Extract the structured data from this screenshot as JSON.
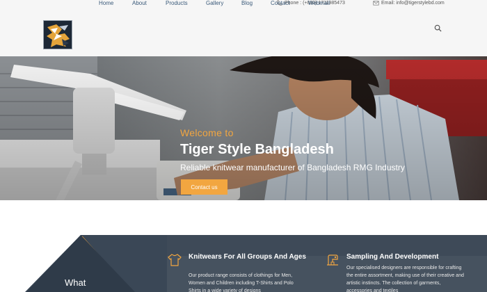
{
  "topbar": {
    "phone": "Phone : (+880) 1711985473",
    "email": "Email: info@tigerstylebd.com"
  },
  "nav": {
    "items": [
      "Home",
      "About",
      "Products",
      "Gallery",
      "Blog",
      "Contact",
      "Webmail"
    ]
  },
  "hero": {
    "welcome": "Welcome to",
    "title": "Tiger Style Bangladesh",
    "subtitle": "Reliable knitwear manufacturer of Bangladesh RMG Industry",
    "button": "Contact us",
    "accent": "#f2a640"
  },
  "features": {
    "what_label": "What",
    "items": [
      {
        "title": "Knitwears For All Groups And Ages",
        "text": "Our product range consists of clothings for Men, Women and Children including T-Shirts and Polo Shirts in a wide variety of designs",
        "icon": "shirt-icon"
      },
      {
        "title": "Sampling And Development",
        "text": "Our specialised designers are responsible for crafting the entire assortment, making use of their creative and artistic instincts. The collection of garments, accessories and textiles",
        "icon": "sewing-machine-icon"
      }
    ]
  }
}
